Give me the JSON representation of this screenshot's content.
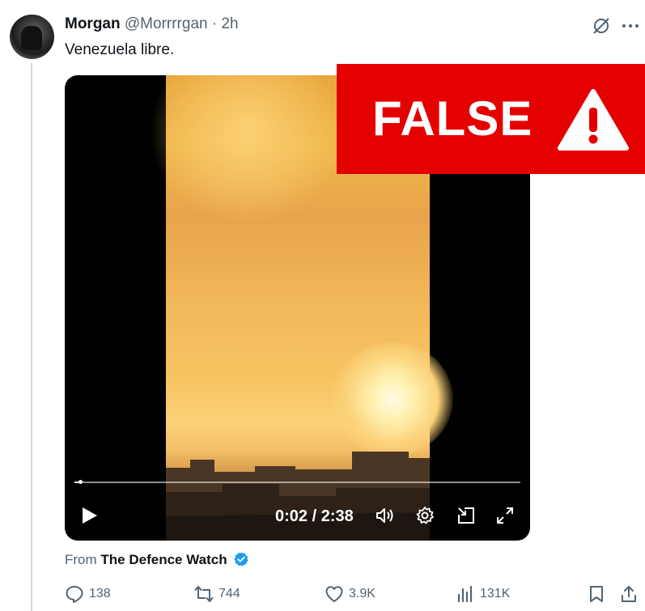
{
  "tweet": {
    "author_name": "Morgan",
    "author_handle": "@Morrrrgan",
    "separator": "·",
    "time": "2h",
    "text": "Venezuela libre."
  },
  "video": {
    "timecode": "0:02 / 2:38",
    "progress": 0.013
  },
  "overlay": {
    "label": "FALSE",
    "color": "#e50000"
  },
  "source": {
    "prefix": "From",
    "name": "The Defence Watch",
    "verified_color": "#1d9bf0"
  },
  "actions": {
    "replies": "138",
    "reposts": "744",
    "likes": "3.9K",
    "views": "131K"
  },
  "icons": [
    "grok-icon",
    "more-icon",
    "play-icon",
    "volume-icon",
    "settings-icon",
    "pip-icon",
    "fullscreen-icon",
    "warning-icon",
    "verified-badge-icon",
    "reply-icon",
    "repost-icon",
    "like-icon",
    "views-icon",
    "bookmark-icon",
    "share-icon"
  ]
}
